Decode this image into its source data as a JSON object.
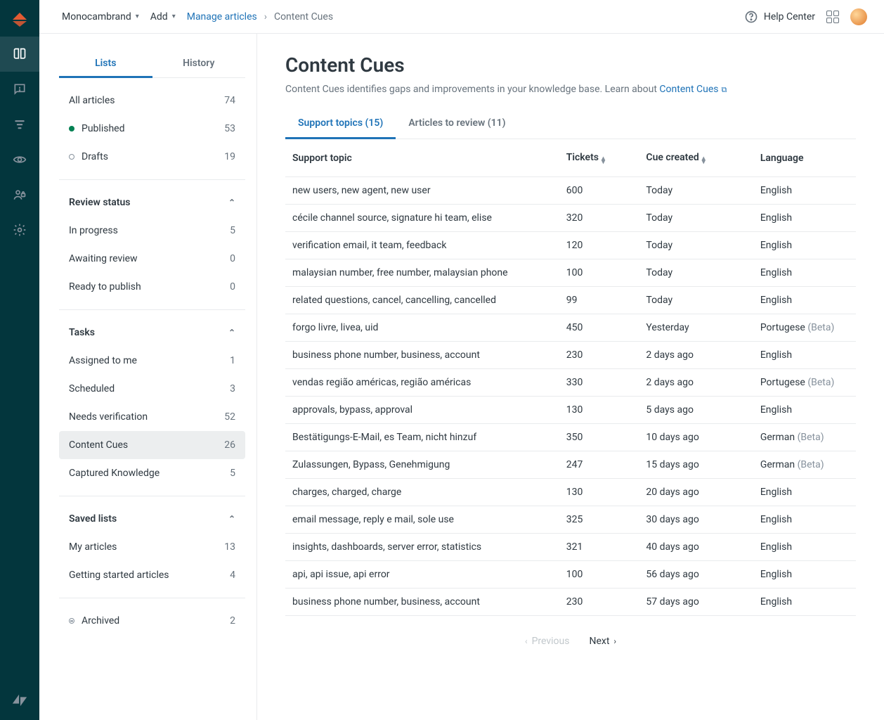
{
  "topbar": {
    "workspace": "Monocambrand",
    "add": "Add",
    "breadcrumb_link": "Manage articles",
    "breadcrumb_current": "Content Cues",
    "help": "Help Center"
  },
  "sidebar": {
    "tabs": {
      "lists": "Lists",
      "history": "History"
    },
    "primary": [
      {
        "label": "All articles",
        "count": "74",
        "dot": null
      },
      {
        "label": "Published",
        "count": "53",
        "dot": "green"
      },
      {
        "label": "Drafts",
        "count": "19",
        "dot": "hollow"
      }
    ],
    "sections": {
      "review": {
        "title": "Review status",
        "items": [
          {
            "label": "In progress",
            "count": "5"
          },
          {
            "label": "Awaiting review",
            "count": "0"
          },
          {
            "label": "Ready to publish",
            "count": "0"
          }
        ]
      },
      "tasks": {
        "title": "Tasks",
        "items": [
          {
            "label": "Assigned to me",
            "count": "1"
          },
          {
            "label": "Scheduled",
            "count": "3"
          },
          {
            "label": "Needs verification",
            "count": "52"
          },
          {
            "label": "Content Cues",
            "count": "26",
            "selected": true
          },
          {
            "label": "Captured Knowledge",
            "count": "5"
          }
        ]
      },
      "saved": {
        "title": "Saved lists",
        "items": [
          {
            "label": "My articles",
            "count": "13"
          },
          {
            "label": "Getting started articles",
            "count": "4"
          }
        ]
      }
    },
    "archived": {
      "label": "Archived",
      "count": "2"
    }
  },
  "page": {
    "title": "Content Cues",
    "desc_prefix": "Content Cues identifies gaps and improvements in your knowledge base. Learn about ",
    "desc_link": "Content Cues",
    "tabs": {
      "support": "Support topics (15)",
      "review": "Articles to review (11)"
    },
    "columns": {
      "topic": "Support topic",
      "tickets": "Tickets",
      "created": "Cue created",
      "lang": "Language"
    },
    "rows": [
      {
        "topic": "new users, new agent, new user",
        "tickets": "600",
        "created": "Today",
        "lang": "English",
        "beta": ""
      },
      {
        "topic": "cécile channel source, signature hi team, elise",
        "tickets": "320",
        "created": "Today",
        "lang": "English",
        "beta": ""
      },
      {
        "topic": "verification email, it team, feedback",
        "tickets": "120",
        "created": "Today",
        "lang": "English",
        "beta": ""
      },
      {
        "topic": "malaysian number, free number, malaysian phone",
        "tickets": "100",
        "created": "Today",
        "lang": "English",
        "beta": ""
      },
      {
        "topic": "related questions, cancel, cancelling, cancelled",
        "tickets": "99",
        "created": "Today",
        "lang": "English",
        "beta": ""
      },
      {
        "topic": "forgo livre, livea, uid",
        "tickets": "450",
        "created": "Yesterday",
        "lang": "Portugese",
        "beta": " (Beta)"
      },
      {
        "topic": "business phone number, business, account",
        "tickets": "230",
        "created": "2 days ago",
        "lang": "English",
        "beta": ""
      },
      {
        "topic": "vendas região américas, região américas",
        "tickets": "330",
        "created": "2 days ago",
        "lang": "Portugese",
        "beta": " (Beta)"
      },
      {
        "topic": "approvals, bypass, approval",
        "tickets": "130",
        "created": "5 days ago",
        "lang": "English",
        "beta": ""
      },
      {
        "topic": "Bestätigungs-E-Mail, es Team, nicht hinzuf",
        "tickets": "350",
        "created": "10 days ago",
        "lang": "German",
        "beta": " (Beta)"
      },
      {
        "topic": "Zulassungen, Bypass, Genehmigung",
        "tickets": "247",
        "created": "15 days ago",
        "lang": "German",
        "beta": " (Beta)"
      },
      {
        "topic": "charges, charged, charge",
        "tickets": "130",
        "created": "20 days ago",
        "lang": "English",
        "beta": ""
      },
      {
        "topic": "email message, reply e mail, sole use",
        "tickets": "325",
        "created": "30 days ago",
        "lang": "English",
        "beta": ""
      },
      {
        "topic": "insights, dashboards, server error, statistics",
        "tickets": "321",
        "created": "40 days ago",
        "lang": "English",
        "beta": ""
      },
      {
        "topic": "api, api issue, api error",
        "tickets": "100",
        "created": "56 days ago",
        "lang": "English",
        "beta": ""
      },
      {
        "topic": "business phone number, business, account",
        "tickets": "230",
        "created": "57 days ago",
        "lang": "English",
        "beta": ""
      }
    ],
    "pager": {
      "prev": "Previous",
      "next": "Next"
    }
  }
}
